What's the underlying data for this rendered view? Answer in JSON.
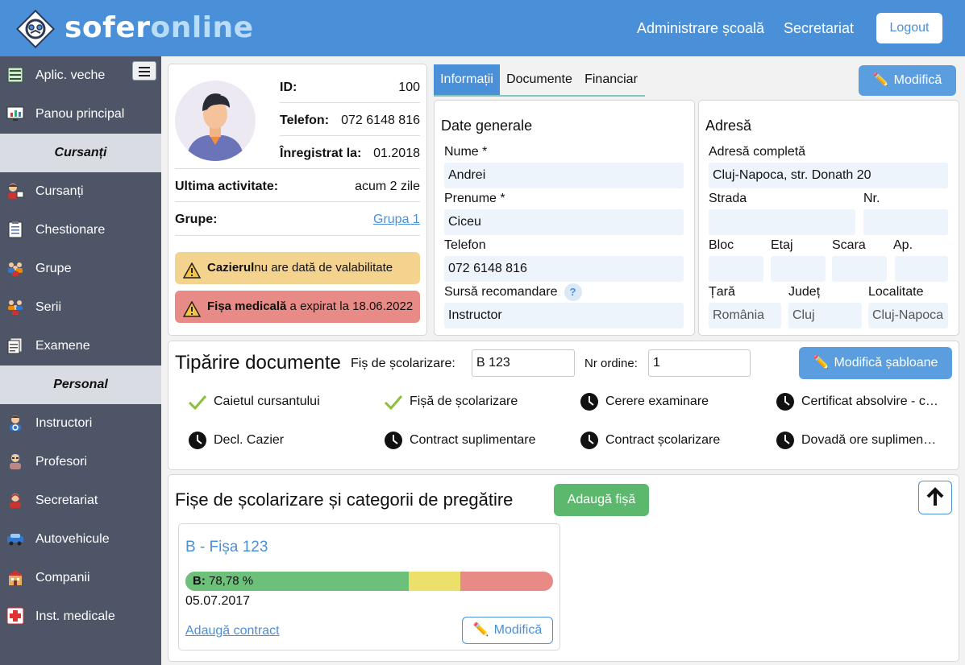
{
  "header": {
    "brand_part1": "sofer",
    "brand_part2": "online",
    "nav": [
      "Administrare școală",
      "Secretariat"
    ],
    "logout_label": "Logout",
    "color": "#4a90d9"
  },
  "sidebar": {
    "items": [
      {
        "label": "Aplic. veche",
        "icon": "table-icon"
      },
      {
        "label": "Panou principal",
        "icon": "dashboard-icon"
      },
      {
        "section": "Cursanți"
      },
      {
        "label": "Cursanți",
        "icon": "student-icon"
      },
      {
        "label": "Chestionare",
        "icon": "clipboard-icon"
      },
      {
        "label": "Grupe",
        "icon": "group-icon"
      },
      {
        "label": "Serii",
        "icon": "series-icon"
      },
      {
        "label": "Examene",
        "icon": "exam-icon"
      },
      {
        "section": "Personal"
      },
      {
        "label": "Instructori",
        "icon": "instructor-icon"
      },
      {
        "label": "Profesori",
        "icon": "teacher-icon"
      },
      {
        "label": "Secretariat",
        "icon": "secretary-icon"
      },
      {
        "label": "Autovehicule",
        "icon": "car-icon"
      },
      {
        "label": "Companii",
        "icon": "building-icon"
      },
      {
        "label": "Inst. medicale",
        "icon": "medical-icon"
      }
    ]
  },
  "profile": {
    "id_label": "ID:",
    "id_value": "100",
    "phone_label": "Telefon:",
    "phone_value": "072 6148 816",
    "registered_label": "Înregistrat la:",
    "registered_value": "01.2018",
    "last_activity_label": "Ultima activitate:",
    "last_activity_value": "acum 2 zile",
    "groups_label": "Grupe:",
    "groups_value": "Grupa 1",
    "alert_cazier_bold": "Cazierul",
    "alert_cazier_text": "nu are dată de valabilitate",
    "alert_medical_bold": "Fișa medicală",
    "alert_medical_text": " a expirat la 18.06.2022"
  },
  "tabs": [
    "Informații",
    "Documente",
    "Financiar"
  ],
  "edit_label": "Modifică",
  "general": {
    "title": "Date generale",
    "nume_label": "Nume *",
    "nume_value": "Andrei",
    "prenume_label": "Prenume *",
    "prenume_value": "Ciceu",
    "telefon_label": "Telefon",
    "telefon_value": "072 6148 816",
    "sursa_label": "Sursă recomandare",
    "sursa_help": "?",
    "sursa_value": "Instructor"
  },
  "address": {
    "title": "Adresă",
    "full_label": "Adresă completă",
    "full_value": "Cluj-Napoca, str. Donath 20",
    "strada_label": "Strada",
    "strada_value": "",
    "nr_label": "Nr.",
    "nr_value": "",
    "bloc_label": "Bloc",
    "etaj_label": "Etaj",
    "scara_label": "Scara",
    "ap_label": "Ap.",
    "tara_label": "Țară",
    "tara_value": "România",
    "judet_label": "Județ",
    "judet_value": "Cluj",
    "localitate_label": "Localitate",
    "localitate_value": "Cluj-Napoca"
  },
  "print": {
    "title": "Tipărire documente",
    "fis_label": "Fiș de școlarizare:",
    "fis_value": "B 123",
    "nr_label": "Nr ordine:",
    "nr_value": "1",
    "templates_label": "Modifică șabloane",
    "docs": [
      {
        "label": "Caietul cursantului",
        "status": "done"
      },
      {
        "label": "Fișă de școlarizare",
        "status": "done"
      },
      {
        "label": "Cerere examinare",
        "status": "pending"
      },
      {
        "label": "Certificat absolvire - curs",
        "status": "pending"
      },
      {
        "label": "Decl. Cazier",
        "status": "pending"
      },
      {
        "label": "Contract suplimentare",
        "status": "pending"
      },
      {
        "label": "Contract școlarizare",
        "status": "pending"
      },
      {
        "label": "Dovadă ore suplimentare",
        "status": "pending"
      }
    ]
  },
  "fise": {
    "title": "Fișe de școlarizare și categorii de pregătire",
    "add_label": "Adaugă fișă",
    "card": {
      "title": "B - Fișa 123",
      "progress_label": "B:",
      "progress_value": "78,78 %",
      "progress_segments": {
        "green": 0.608,
        "yellow": 0.14,
        "red": 0.252
      },
      "date": "05.07.2017",
      "add_contract": "Adaugă contract",
      "edit_label": "Modifică"
    }
  }
}
